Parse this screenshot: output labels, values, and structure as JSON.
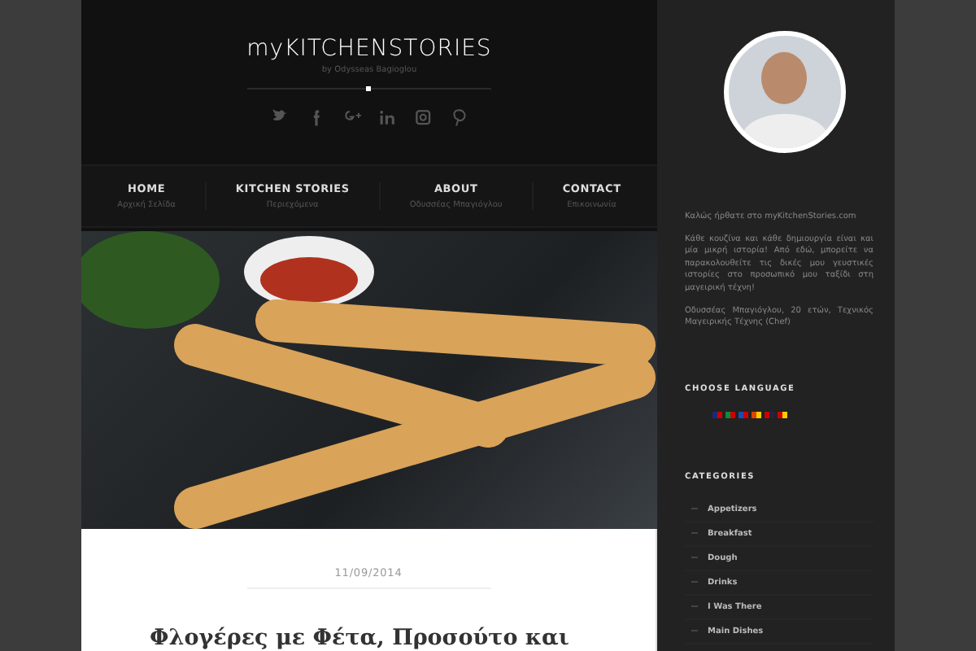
{
  "header": {
    "logo": "myKITCHENSTORIES",
    "byline": "by Odysseas Bagioglou"
  },
  "nav": [
    {
      "label": "HOME",
      "sub": "Αρχική Σελίδα"
    },
    {
      "label": "KITCHEN STORIES",
      "sub": "Περιεχόμενα"
    },
    {
      "label": "ABOUT",
      "sub": "Οδυσσέας Μπαγιόγλου"
    },
    {
      "label": "CONTACT",
      "sub": "Επικοινωνία"
    }
  ],
  "post": {
    "date": "11/09/2014",
    "title": "Φλογέρες με Φέτα, Προσούτο και"
  },
  "sidebar": {
    "welcome": "Καλώς ήρθατε στο myKitchenStories.com",
    "paragraphs": [
      "Κάθε κουζίνα και κάθε δημιουργία είναι και μία μικρή ιστορία! Από εδώ, μπορείτε να παρακολουθείτε τις δικές μου γευστικές ιστορίες στο προσωπικό μου ταξίδι στη μαγειρική τέχνη!",
      "Οδυσσέας Μπαγιόγλου, 20 ετών, Τεχνικός Μαγειρικής Τέχνης (Chef)"
    ],
    "language_heading": "CHOOSE LANGUAGE",
    "categories_heading": "CATEGORIES",
    "categories": [
      "Appetizers",
      "Breakfast",
      "Dough",
      "Drinks",
      "I Was There",
      "Main Dishes"
    ]
  }
}
